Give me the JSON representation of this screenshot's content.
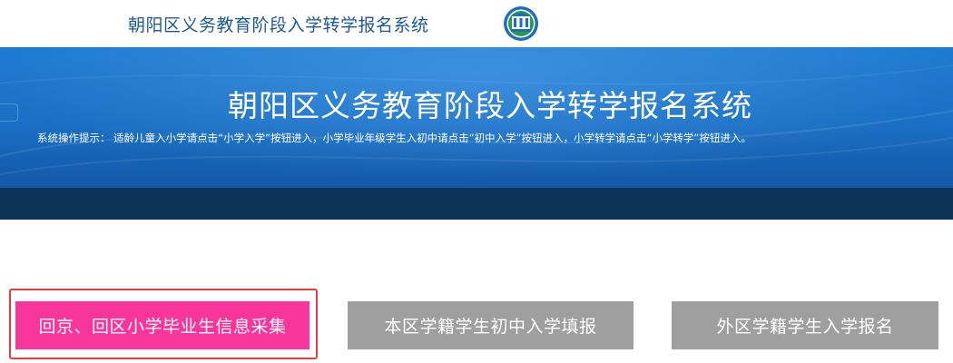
{
  "header": {
    "title": "朝阳区义务教育阶段入学转学报名系统",
    "logo_icon": "education-emblem-icon"
  },
  "banner": {
    "title": "朝阳区义务教育阶段入学转学报名系统",
    "hint": "系统操作提示：  适龄儿童入小学请点击“小学入学”按钮进入，小学毕业年级学生入初中请点击“初中入学”按钮进入，小学转学请点击“小学转学”按钮进入。"
  },
  "actions": {
    "primary_label": "回京、回区小学毕业生信息采集",
    "local_label": "本区学籍学生初中入学填报",
    "external_label": "外区学籍学生入学报名"
  },
  "colors": {
    "primary_button": "#f7359a",
    "secondary_button": "#9f9f9f",
    "highlight_border": "#e63b3b",
    "title_text": "#1c5a93"
  }
}
